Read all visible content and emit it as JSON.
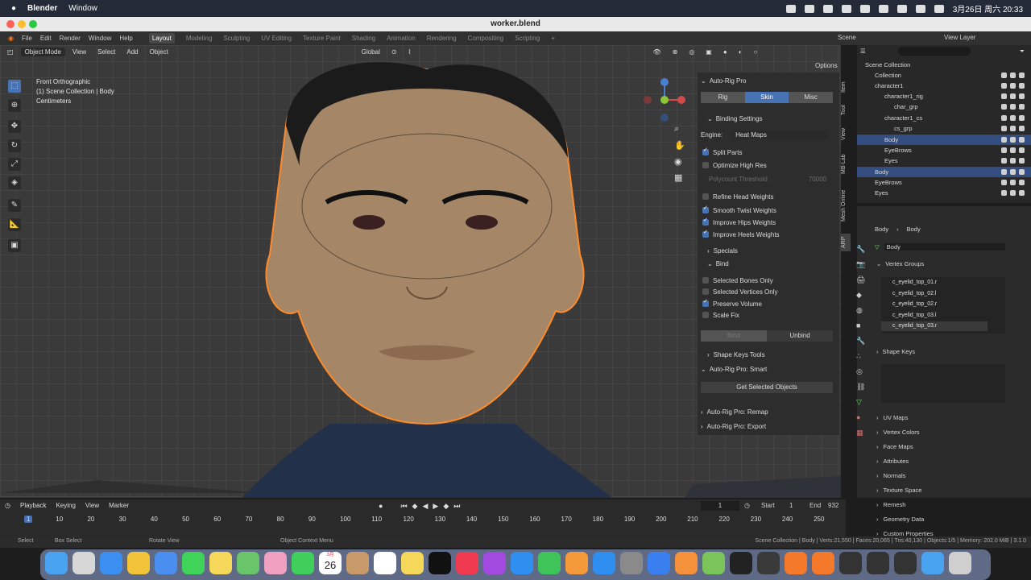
{
  "mac": {
    "app": "Blender",
    "menu": "Window",
    "datetime": "3月26日 周六 20:33"
  },
  "window": {
    "title": "worker.blend"
  },
  "menus": [
    "File",
    "Edit",
    "Render",
    "Window",
    "Help"
  ],
  "workspaces": [
    "Layout",
    "Modeling",
    "Sculpting",
    "UV Editing",
    "Texture Paint",
    "Shading",
    "Animation",
    "Rendering",
    "Compositing",
    "Scripting"
  ],
  "scene": "Scene",
  "view_layer": "View Layer",
  "viewport": {
    "mode": "Object Mode",
    "menus": [
      "View",
      "Select",
      "Add",
      "Object"
    ],
    "orientation": "Global",
    "options": "Options",
    "info": [
      "Front Orthographic",
      "(1) Scene Collection | Body",
      "Centimeters"
    ]
  },
  "npanel": {
    "title": "Auto-Rig Pro",
    "tabs": [
      "Rig",
      "Skin",
      "Misc"
    ],
    "active_tab": "Skin",
    "binding_settings": "Binding Settings",
    "engine_label": "Engine:",
    "engine_value": "Heat Maps",
    "split_parts": "Split Parts",
    "optimize_high_res": "Optimize High Res",
    "polycount_label": "Polycount Threshold",
    "polycount_value": "70000",
    "refine_head": "Refine Head Weights",
    "smooth_twist": "Smooth Twist Weights",
    "improve_hips": "Improve Hips Weights",
    "improve_heels": "Improve Heels Weights",
    "specials": "Specials",
    "bind_section": "Bind",
    "selected_bones_only": "Selected Bones Only",
    "selected_vertices_only": "Selected Vertices Only",
    "preserve_volume": "Preserve Volume",
    "scale_fix": "Scale Fix",
    "bind_button": "Bind",
    "unbind_button": "Unbind",
    "shape_keys_tools": "Shape Keys Tools",
    "smart": "Auto-Rig Pro: Smart",
    "get_selected": "Get Selected Objects",
    "remap": "Auto-Rig Pro: Remap",
    "export": "Auto-Rig Pro: Export",
    "side_tabs": [
      "Item",
      "Tool",
      "View",
      "MB-Lab",
      "Mesh Online",
      "ARP"
    ]
  },
  "outliner": {
    "rows": [
      {
        "label": "Scene Collection",
        "indent": 0
      },
      {
        "label": "Collection",
        "indent": 1
      },
      {
        "label": "character1",
        "indent": 1
      },
      {
        "label": "character1_rig",
        "indent": 2
      },
      {
        "label": "char_grp",
        "indent": 3
      },
      {
        "label": "character1_cs",
        "indent": 2
      },
      {
        "label": "cs_grp",
        "indent": 3
      },
      {
        "label": "Body",
        "indent": 2
      },
      {
        "label": "EyeBrows",
        "indent": 2
      },
      {
        "label": "Eyes",
        "indent": 2
      },
      {
        "label": "Body",
        "indent": 1
      },
      {
        "label": "EyeBrows",
        "indent": 1
      },
      {
        "label": "Eyes",
        "indent": 1
      }
    ]
  },
  "properties": {
    "breadcrumb_object": "Body",
    "breadcrumb_mesh": "Body",
    "mesh_name": "Body",
    "vertex_groups_title": "Vertex Groups",
    "vertex_groups": [
      "c_eyelid_top_01.r",
      "c_eyelid_top_02.l",
      "c_eyelid_top_02.r",
      "c_eyelid_top_03.l",
      "c_eyelid_top_03.r"
    ],
    "shape_keys": "Shape Keys",
    "sections": [
      "UV Maps",
      "Vertex Colors",
      "Face Maps",
      "Attributes",
      "Normals",
      "Texture Space",
      "Remesh",
      "Geometry Data",
      "Custom Properties"
    ]
  },
  "timeline": {
    "menus": [
      "Playback",
      "Keying",
      "View",
      "Marker"
    ],
    "current": "1",
    "start_label": "Start",
    "start": "1",
    "end_label": "End",
    "end": "932",
    "ticks": [
      "1",
      "10",
      "20",
      "30",
      "40",
      "50",
      "60",
      "70",
      "80",
      "90",
      "100",
      "110",
      "120",
      "130",
      "140",
      "150",
      "160",
      "170",
      "180",
      "190",
      "200",
      "210",
      "220",
      "230",
      "240",
      "250"
    ]
  },
  "status": {
    "select": "Select",
    "box_select": "Box Select",
    "rotate_view": "Rotate View",
    "context_menu": "Object Context Menu",
    "info": "Scene Collection | Body | Verts:21,550 | Faces:20,065 | Tris:40,130 | Objects:1/5 | Memory: 202.0 MiB | 3.1.0"
  },
  "dock": {
    "calendar_month": "3月",
    "calendar_day": "26"
  }
}
